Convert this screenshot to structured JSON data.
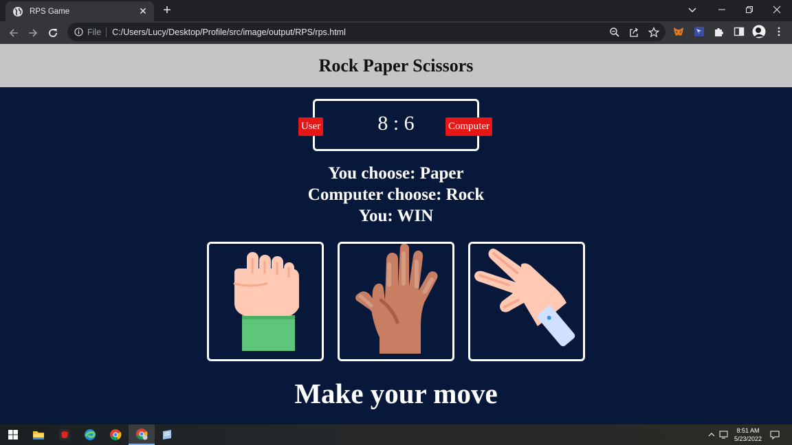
{
  "browser": {
    "tab_title": "RPS Game",
    "tab_close": "✕",
    "new_tab": "+",
    "omnibox_scheme": "File",
    "url": "C:/Users/Lucy/Desktop/Profile/src/image/output/RPS/rps.html"
  },
  "game": {
    "title": "Rock Paper Scissors",
    "score": "8 : 6",
    "user_label": "User",
    "computer_label": "Computer",
    "result_lines": [
      "You choose: Paper",
      "Computer choose: Rock",
      "You: WIN"
    ],
    "choices": [
      "rock-fist",
      "paper-open-hand",
      "scissors-hand"
    ],
    "prompt": "Make your move"
  },
  "colors": {
    "page_background": "#08183a",
    "header_background": "#c5c5c8",
    "badge_red": "#e81717"
  },
  "taskbar": {
    "time": "8:51 AM",
    "date": "5/23/2022"
  }
}
